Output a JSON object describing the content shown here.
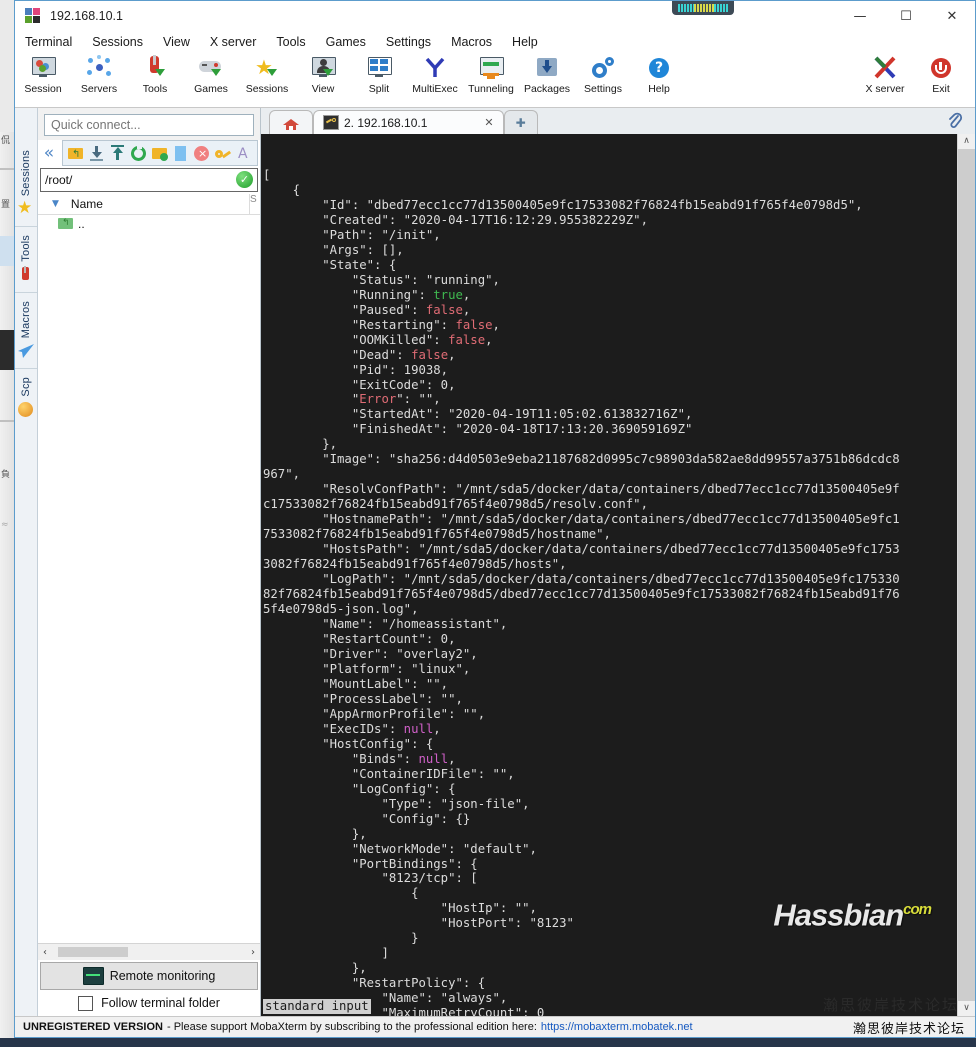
{
  "window": {
    "title": "192.168.10.1",
    "icon": "mobaxterm-logo-icon",
    "minimize": "—",
    "maximize": "☐",
    "close": "✕"
  },
  "menubar": {
    "items": [
      {
        "label": "Terminal"
      },
      {
        "label": "Sessions"
      },
      {
        "label": "View"
      },
      {
        "label": "X server"
      },
      {
        "label": "Tools"
      },
      {
        "label": "Games"
      },
      {
        "label": "Settings"
      },
      {
        "label": "Macros"
      },
      {
        "label": "Help"
      }
    ]
  },
  "toolbar": {
    "left_buttons": [
      {
        "label": "Session",
        "icon": "session-monitor-icon"
      },
      {
        "label": "Servers",
        "icon": "servers-nodes-icon"
      },
      {
        "label": "Tools",
        "icon": "swiss-knife-icon"
      },
      {
        "label": "Games",
        "icon": "gamepad-icon"
      },
      {
        "label": "Sessions",
        "icon": "star-icon"
      },
      {
        "label": "View",
        "icon": "view-person-monitor-icon"
      },
      {
        "label": "Split",
        "icon": "split-grid-icon"
      },
      {
        "label": "MultiExec",
        "icon": "multiexec-fork-icon"
      },
      {
        "label": "Tunneling",
        "icon": "tunneling-arrows-icon"
      },
      {
        "label": "Packages",
        "icon": "packages-download-icon"
      },
      {
        "label": "Settings",
        "icon": "gear-icon"
      },
      {
        "label": "Help",
        "icon": "help-question-icon"
      }
    ],
    "right_buttons": [
      {
        "label": "X server",
        "icon": "x-server-icon"
      },
      {
        "label": "Exit",
        "icon": "power-exit-icon"
      }
    ]
  },
  "sidebar_rail": {
    "sections": [
      {
        "label": "Sessions",
        "icon": "star-icon"
      },
      {
        "label": "Tools",
        "icon": "swiss-knife-icon"
      },
      {
        "label": "Macros",
        "icon": "paper-plane-icon"
      },
      {
        "label": "Scp",
        "icon": "globe-icon"
      }
    ]
  },
  "left_pane": {
    "quick_connect_placeholder": "Quick connect...",
    "collapse_icon": "chevron-double-left-icon",
    "sftp_tools": [
      {
        "icon": "up-folder-icon"
      },
      {
        "icon": "download-icon"
      },
      {
        "icon": "upload-icon"
      },
      {
        "icon": "refresh-icon"
      },
      {
        "icon": "new-folder-icon"
      },
      {
        "icon": "new-file-icon"
      },
      {
        "icon": "delete-icon"
      },
      {
        "icon": "permissions-key-icon"
      },
      {
        "icon": "text-mode-icon"
      }
    ],
    "path_value": "/root/",
    "path_status_icon": "check-circle-icon",
    "column_header": "Name",
    "column_header_size": "S",
    "sort_caret": "▼",
    "files": [
      {
        "name": "..",
        "icon": "parent-folder-icon"
      }
    ],
    "hscroll_left": "‹",
    "hscroll_right": "›",
    "remote_monitoring_label": "Remote monitoring",
    "remote_monitoring_icon": "monitor-graph-icon",
    "follow_terminal_label": "Follow terminal folder",
    "follow_terminal_checked": false
  },
  "tabs": {
    "home_icon": "home-icon",
    "items": [
      {
        "label": "2. 192.168.10.1",
        "icon": "ssh-key-icon",
        "active": true,
        "close": "✕"
      }
    ],
    "new_tab_icon": "plus-icon",
    "clip_icon": "paperclip-icon"
  },
  "terminal": {
    "pager_status": "standard input",
    "scroll_up": "∧",
    "scroll_down": "∨",
    "lines": [
      [
        {
          "t": "["
        }
      ],
      [
        {
          "t": "    {"
        }
      ],
      [
        {
          "t": "        \"Id\": \"dbed77ecc1cc77d13500405e9fc17533082f76824fb15eabd91f765f4e0798d5\","
        }
      ],
      [
        {
          "t": "        \"Created\": \"2020-04-17T16:12:29.955382229Z\","
        }
      ],
      [
        {
          "t": "        \"Path\": \"/init\","
        }
      ],
      [
        {
          "t": "        \"Args\": [],"
        }
      ],
      [
        {
          "t": "        \"State\": {"
        }
      ],
      [
        {
          "t": "            \"Status\": \"running\","
        }
      ],
      [
        {
          "t": "            \"Running\": "
        },
        {
          "t": "true",
          "c": "t-true"
        },
        {
          "t": ","
        }
      ],
      [
        {
          "t": "            \"Paused\": "
        },
        {
          "t": "false",
          "c": "t-false"
        },
        {
          "t": ","
        }
      ],
      [
        {
          "t": "            \"Restarting\": "
        },
        {
          "t": "false",
          "c": "t-false"
        },
        {
          "t": ","
        }
      ],
      [
        {
          "t": "            \"OOMKilled\": "
        },
        {
          "t": "false",
          "c": "t-false"
        },
        {
          "t": ","
        }
      ],
      [
        {
          "t": "            \"Dead\": "
        },
        {
          "t": "false",
          "c": "t-false"
        },
        {
          "t": ","
        }
      ],
      [
        {
          "t": "            \"Pid\": 19038,"
        }
      ],
      [
        {
          "t": "            \"ExitCode\": 0,"
        }
      ],
      [
        {
          "t": "            \""
        },
        {
          "t": "Error",
          "c": "t-err"
        },
        {
          "t": "\": \"\","
        }
      ],
      [
        {
          "t": "            \"StartedAt\": \"2020-04-19T11:05:02.613832716Z\","
        }
      ],
      [
        {
          "t": "            \"FinishedAt\": \"2020-04-18T17:13:20.369059169Z\""
        }
      ],
      [
        {
          "t": "        },"
        }
      ],
      [
        {
          "t": "        \"Image\": \"sha256:d4d0503e9eba21187682d0995c7c98903da582ae8dd99557a3751b86dcdc8"
        }
      ],
      [
        {
          "t": "967\","
        }
      ],
      [
        {
          "t": "        \"ResolvConfPath\": \"/mnt/sda5/docker/data/containers/dbed77ecc1cc77d13500405e9f"
        }
      ],
      [
        {
          "t": "c17533082f76824fb15eabd91f765f4e0798d5/resolv.conf\","
        }
      ],
      [
        {
          "t": "        \"HostnamePath\": \"/mnt/sda5/docker/data/containers/dbed77ecc1cc77d13500405e9fc1"
        }
      ],
      [
        {
          "t": "7533082f76824fb15eabd91f765f4e0798d5/hostname\","
        }
      ],
      [
        {
          "t": "        \"HostsPath\": \"/mnt/sda5/docker/data/containers/dbed77ecc1cc77d13500405e9fc1753"
        }
      ],
      [
        {
          "t": "3082f76824fb15eabd91f765f4e0798d5/hosts\","
        }
      ],
      [
        {
          "t": "        \"LogPath\": \"/mnt/sda5/docker/data/containers/dbed77ecc1cc77d13500405e9fc175330"
        }
      ],
      [
        {
          "t": "82f76824fb15eabd91f765f4e0798d5/dbed77ecc1cc77d13500405e9fc17533082f76824fb15eabd91f76"
        }
      ],
      [
        {
          "t": "5f4e0798d5-json.log\","
        }
      ],
      [
        {
          "t": "        \"Name\": \"/homeassistant\","
        }
      ],
      [
        {
          "t": "        \"RestartCount\": 0,"
        }
      ],
      [
        {
          "t": "        \"Driver\": \"overlay2\","
        }
      ],
      [
        {
          "t": "        \"Platform\": \"linux\","
        }
      ],
      [
        {
          "t": "        \"MountLabel\": \"\","
        }
      ],
      [
        {
          "t": "        \"ProcessLabel\": \"\","
        }
      ],
      [
        {
          "t": "        \"AppArmorProfile\": \"\","
        }
      ],
      [
        {
          "t": "        \"ExecIDs\": "
        },
        {
          "t": "null",
          "c": "t-null"
        },
        {
          "t": ","
        }
      ],
      [
        {
          "t": "        \"HostConfig\": {"
        }
      ],
      [
        {
          "t": "            \"Binds\": "
        },
        {
          "t": "null",
          "c": "t-null"
        },
        {
          "t": ","
        }
      ],
      [
        {
          "t": "            \"ContainerIDFile\": \"\","
        }
      ],
      [
        {
          "t": "            \"LogConfig\": {"
        }
      ],
      [
        {
          "t": "                \"Type\": \"json-file\","
        }
      ],
      [
        {
          "t": "                \"Config\": {}"
        }
      ],
      [
        {
          "t": "            },"
        }
      ],
      [
        {
          "t": "            \"NetworkMode\": \"default\","
        }
      ],
      [
        {
          "t": "            \"PortBindings\": {"
        }
      ],
      [
        {
          "t": "                \"8123/tcp\": ["
        }
      ],
      [
        {
          "t": "                    {"
        }
      ],
      [
        {
          "t": "                        \"HostIp\": \"\","
        }
      ],
      [
        {
          "t": "                        \"HostPort\": \"8123\""
        }
      ],
      [
        {
          "t": "                    }"
        }
      ],
      [
        {
          "t": "                ]"
        }
      ],
      [
        {
          "t": "            },"
        }
      ],
      [
        {
          "t": "            \"RestartPolicy\": {"
        }
      ],
      [
        {
          "t": "                \"Name\": \"always\","
        }
      ],
      [
        {
          "t": "                \"MaximumRetryCount\": 0"
        }
      ],
      [
        {
          "t": "            },"
        }
      ]
    ]
  },
  "watermark": {
    "main": "Hassbian",
    "tld": "com",
    "subtitle": "瀚思彼岸技术论坛"
  },
  "statusbar": {
    "unregistered": "UNREGISTERED VERSION",
    "message": "- Please support MobaXterm by subscribing to the professional edition here:",
    "link": "https://mobaxterm.mobatek.net",
    "watermark_cn": "瀚思彼岸技术论坛"
  },
  "colors": {
    "accent": "#5c9ccc",
    "terminal_bg": "#1c1c1c",
    "terminal_fg": "#dcdcdc",
    "true_green": "#3fb950",
    "false_red": "#e06c75",
    "null_magenta": "#d060c8",
    "link_blue": "#1558c0"
  }
}
